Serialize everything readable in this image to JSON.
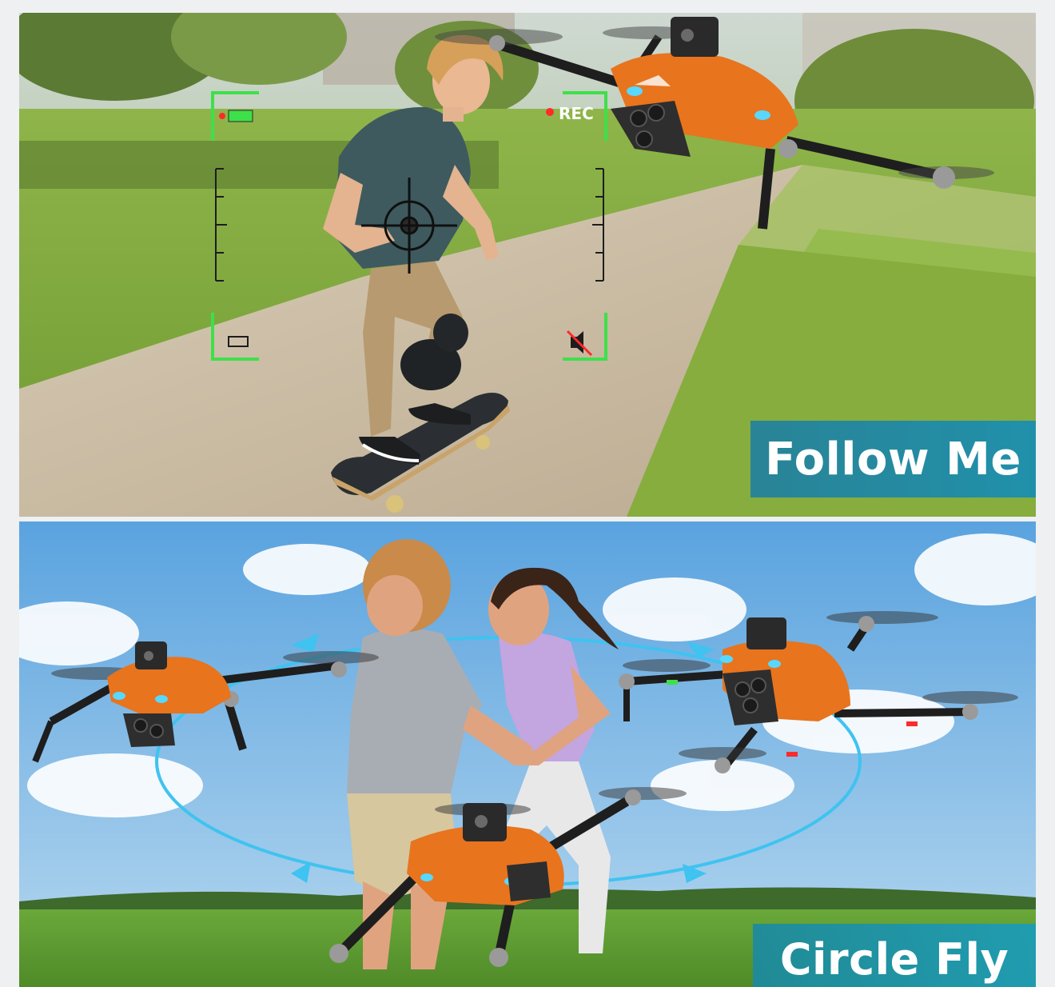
{
  "panels": {
    "follow_me": {
      "label": "Follow Me",
      "hud_rec": "REC",
      "label_bg": "#1f7fa0"
    },
    "circle_fly": {
      "label": "Circle Fly",
      "label_bg": "#1a8aa2"
    }
  },
  "colors": {
    "hud_green": "#3ee04a",
    "rec_red": "#ff2a2a",
    "drone_orange": "#e8741e",
    "orbit_blue": "#3fc3f0"
  }
}
